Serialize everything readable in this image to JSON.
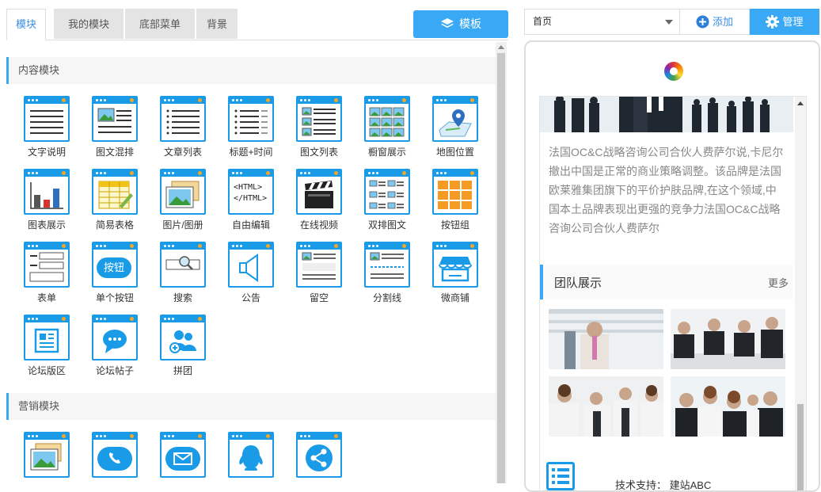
{
  "tabs": [
    {
      "label": "模块",
      "active": true
    },
    {
      "label": "我的模块",
      "active": false
    },
    {
      "label": "底部菜单",
      "active": false
    },
    {
      "label": "背景",
      "active": false
    }
  ],
  "template_button": {
    "label": "模板",
    "icon": "layers-icon"
  },
  "sections": [
    {
      "title": "内容模块",
      "modules": [
        {
          "label": "文字说明",
          "icon": "text-lines-icon"
        },
        {
          "label": "图文混排",
          "icon": "image-text-icon"
        },
        {
          "label": "文章列表",
          "icon": "article-list-icon"
        },
        {
          "label": "标题+时间",
          "icon": "title-time-icon"
        },
        {
          "label": "图文列表",
          "icon": "image-list-icon"
        },
        {
          "label": "橱窗展示",
          "icon": "showcase-icon"
        },
        {
          "label": "地图位置",
          "icon": "map-pin-icon"
        },
        {
          "label": "图表展示",
          "icon": "bar-chart-icon"
        },
        {
          "label": "简易表格",
          "icon": "table-icon"
        },
        {
          "label": "图片/图册",
          "icon": "photo-album-icon"
        },
        {
          "label": "自由编辑",
          "icon": "html-code-icon",
          "icon_text": [
            "<HTML>",
            "</HTML>"
          ]
        },
        {
          "label": "在线视频",
          "icon": "video-clapper-icon"
        },
        {
          "label": "双排图文",
          "icon": "double-column-icon"
        },
        {
          "label": "按钮组",
          "icon": "button-group-icon"
        },
        {
          "label": "表单",
          "icon": "form-icon"
        },
        {
          "label": "单个按钮",
          "icon": "single-button-icon",
          "icon_text": [
            "按钮"
          ]
        },
        {
          "label": "搜索",
          "icon": "search-icon"
        },
        {
          "label": "公告",
          "icon": "megaphone-icon"
        },
        {
          "label": "留空",
          "icon": "blank-space-icon"
        },
        {
          "label": "分割线",
          "icon": "divider-line-icon"
        },
        {
          "label": "微商铺",
          "icon": "shop-icon"
        },
        {
          "label": "论坛版区",
          "icon": "forum-board-icon"
        },
        {
          "label": "论坛帖子",
          "icon": "chat-bubble-icon"
        },
        {
          "label": "拼团",
          "icon": "group-buy-icon"
        }
      ]
    },
    {
      "title": "营销模块",
      "modules": [
        {
          "label": "",
          "icon": "gallery-icon"
        },
        {
          "label": "",
          "icon": "phone-icon"
        },
        {
          "label": "",
          "icon": "mail-icon"
        },
        {
          "label": "",
          "icon": "qq-icon"
        },
        {
          "label": "",
          "icon": "share-icon"
        }
      ]
    }
  ],
  "page_select": {
    "value": "首页"
  },
  "add_button": {
    "label": "添加",
    "icon": "plus-circle-icon"
  },
  "manage_button": {
    "label": "管理",
    "icon": "gear-icon"
  },
  "preview": {
    "news_text": "法国OC&C战略咨询公司合伙人费萨尔说,卡尼尔撤出中国是正常的商业策略调整。该品牌是法国欧莱雅集团旗下的平价护肤品牌,在这个领域,中国本土品牌表现出更强的竞争力法国OC&C战略咨询公司合伙人费萨尔",
    "team_title": "团队展示",
    "team_more": "更多",
    "support_text": "技术支持：  建站ABC"
  },
  "colors": {
    "accent": "#39a8f5",
    "icon_border": "#1a9be8",
    "orange": "#f5a623"
  }
}
